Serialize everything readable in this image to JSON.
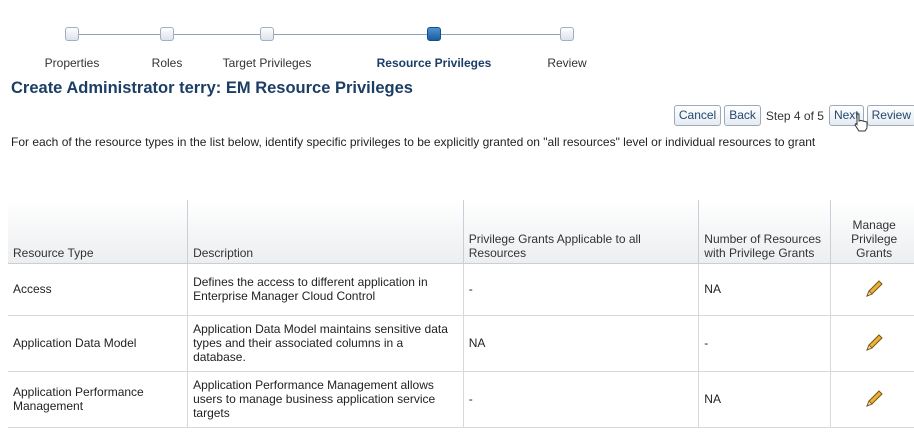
{
  "train": {
    "steps": [
      {
        "label": "Properties",
        "active": false
      },
      {
        "label": "Roles",
        "active": false
      },
      {
        "label": "Target Privileges",
        "active": false
      },
      {
        "label": "Resource Privileges",
        "active": true
      },
      {
        "label": "Review",
        "active": false
      }
    ]
  },
  "page_title": "Create Administrator terry: EM Resource Privileges",
  "nav": {
    "cancel": "Cancel",
    "back": "Back",
    "step_text": "Step 4 of 5",
    "next": "Next",
    "review": "Review"
  },
  "instructions": "For each of the resource types in the list below, identify specific privileges to be explicitly granted on \"all resources\" level or individual resources to grant",
  "table": {
    "headers": {
      "resource_type": "Resource Type",
      "description": "Description",
      "privilege_grants_all": "Privilege Grants Applicable to all Resources",
      "number_of_resources": "Number of Resources with Privilege Grants",
      "manage": "Manage Privilege Grants"
    },
    "rows": [
      {
        "resource_type": "Access",
        "description": "Defines the access to different application in Enterprise Manager Cloud Control",
        "privilege_grants_all": "-",
        "number_of_resources": "NA"
      },
      {
        "resource_type": "Application Data Model",
        "description": "Application Data Model maintains sensitive data types and their associated columns in a database.",
        "privilege_grants_all": "NA",
        "number_of_resources": "-"
      },
      {
        "resource_type": "Application Performance Management",
        "description": "Application Performance Management allows users to manage business application service targets",
        "privilege_grants_all": "-",
        "number_of_resources": "NA"
      }
    ]
  },
  "colors": {
    "title": "#1c3e66",
    "active_step": "#1b5d9e",
    "pencil": "#d49a1c"
  }
}
